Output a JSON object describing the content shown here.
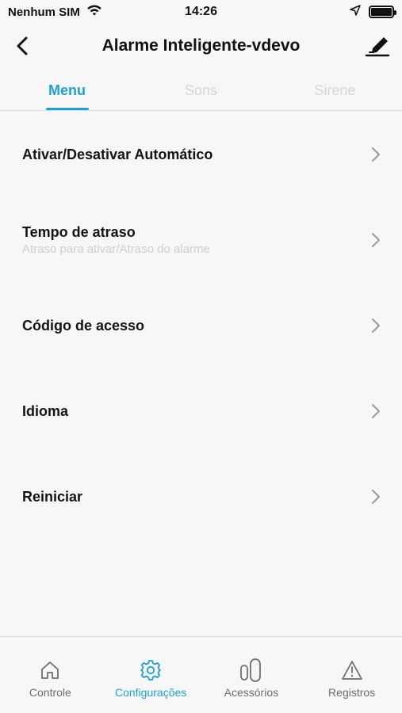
{
  "status_bar": {
    "carrier": "Nenhum SIM",
    "time": "14:26",
    "battery_level": 1.0
  },
  "header": {
    "title": "Alarme Inteligente-vdevo",
    "back_icon": "chevron-left-icon",
    "edit_icon": "pen-edit-icon"
  },
  "tabs": [
    {
      "label": "Menu",
      "active": true
    },
    {
      "label": "Sons",
      "active": false
    },
    {
      "label": "Sirene",
      "active": false
    }
  ],
  "menu": [
    {
      "label": "Ativar/Desativar Automático",
      "sub": ""
    },
    {
      "label": "Tempo de atraso",
      "sub": "Atraso para ativar/Atraso do alarme"
    },
    {
      "label": "Código de acesso",
      "sub": ""
    },
    {
      "label": "Idioma",
      "sub": ""
    },
    {
      "label": "Reiniciar",
      "sub": ""
    }
  ],
  "bottom_nav": [
    {
      "label": "Controle",
      "icon": "home-icon",
      "active": false
    },
    {
      "label": "Configurações",
      "icon": "gear-icon",
      "active": true
    },
    {
      "label": "Acessórios",
      "icon": "sensor-icon",
      "active": false
    },
    {
      "label": "Registros",
      "icon": "warning-icon",
      "active": false
    }
  ],
  "colors": {
    "accent": "#1ea0d6",
    "inactive_tab": "#d6d6d6",
    "background": "#f7f7f7"
  }
}
